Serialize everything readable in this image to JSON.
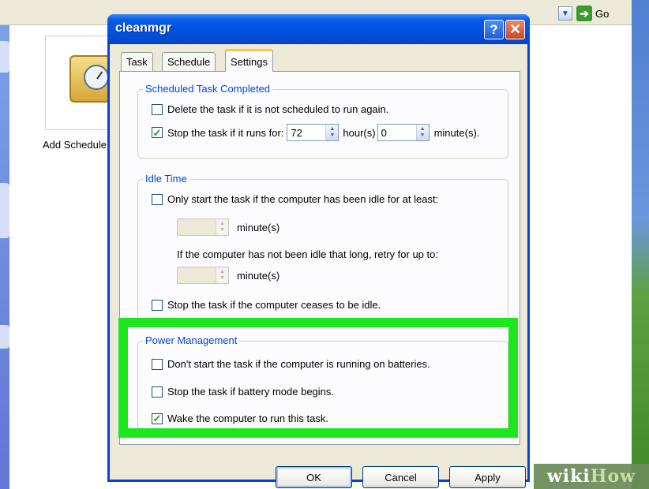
{
  "background_window": {
    "go_label": "Go",
    "add_task_label": "Add Schedule"
  },
  "dialog": {
    "title": "cleanmgr",
    "help_glyph": "?",
    "close_glyph": "✕",
    "tabs": [
      {
        "label": "Task",
        "active": false
      },
      {
        "label": "Schedule",
        "active": false
      },
      {
        "label": "Settings",
        "active": true
      }
    ],
    "scheduled_completed": {
      "legend": "Scheduled Task Completed",
      "delete_label": "Delete the task if it is not scheduled to run again.",
      "delete_checked": false,
      "stop_label": "Stop the task if it runs for:",
      "stop_checked": true,
      "hours_value": "72",
      "hours_unit": "hour(s)",
      "minutes_value": "0",
      "minutes_unit": "minute(s)."
    },
    "idle_time": {
      "legend": "Idle Time",
      "only_start_label": "Only start the task if the computer has been idle for at least:",
      "only_start_checked": false,
      "idle_minutes_unit": "minute(s)",
      "retry_text": "If the computer has not been idle that long, retry for up to:",
      "retry_minutes_unit": "minute(s)",
      "stop_idle_label": "Stop the task if the computer ceases to be idle.",
      "stop_idle_checked": false
    },
    "power_management": {
      "legend": "Power Management",
      "batteries_label": "Don't start the task if the computer is running on batteries.",
      "batteries_checked": false,
      "battery_mode_label": "Stop the task if battery mode begins.",
      "battery_mode_checked": false,
      "wake_label": "Wake the computer to run this task.",
      "wake_checked": true
    },
    "buttons": {
      "ok": "OK",
      "cancel": "Cancel",
      "apply": "Apply"
    }
  },
  "watermark": {
    "wiki": "wiki",
    "how": "How"
  },
  "colors": {
    "highlight": "#1ee61e",
    "titlebar": "#0051e0",
    "legend_text": "#0046d5"
  }
}
